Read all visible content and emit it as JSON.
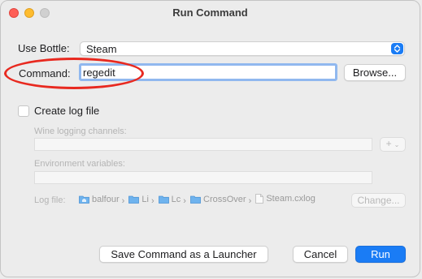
{
  "window": {
    "title": "Run Command"
  },
  "bottle": {
    "label": "Use Bottle:",
    "value": "Steam"
  },
  "command": {
    "label": "Command:",
    "value": "regedit"
  },
  "browse_label": "Browse...",
  "log": {
    "checkbox_label": "Create log file",
    "channels_label": "Wine logging channels:",
    "add_label": "+",
    "env_label": "Environment variables:",
    "file_label": "Log file:",
    "path": [
      "balfour",
      "Li",
      "Lc",
      "CrossOver",
      "Steam.cxlog"
    ],
    "change_label": "Change..."
  },
  "actions": {
    "save_launcher": "Save Command as a Launcher",
    "cancel": "Cancel",
    "run": "Run"
  },
  "colors": {
    "accent": "#1a7cf5",
    "annotation": "#e8291f"
  }
}
